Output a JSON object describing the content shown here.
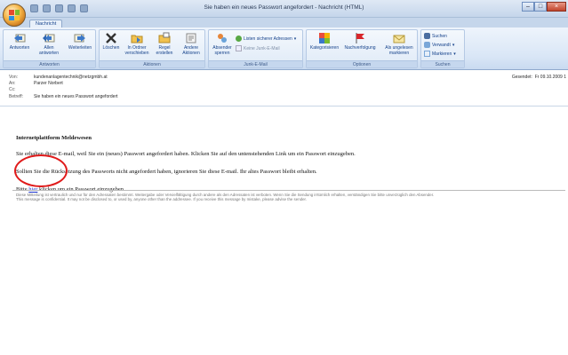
{
  "window": {
    "title": "Sie haben ein neues Passwort angefordert - Nachricht (HTML)"
  },
  "tabs": [
    {
      "label": "Nachricht"
    }
  ],
  "ribbon": {
    "groups": {
      "antworten": {
        "label": "Antworten",
        "buttons": [
          {
            "label": "Antworten",
            "icon": "reply-icon"
          },
          {
            "label": "Allen antworten",
            "icon": "reply-all-icon"
          },
          {
            "label": "Weiterleiten",
            "icon": "forward-icon"
          }
        ]
      },
      "aktionen": {
        "label": "Aktionen",
        "buttons": [
          {
            "label": "Löschen",
            "icon": "delete-icon"
          },
          {
            "label": "In Ordner verschieben",
            "icon": "move-to-folder-icon"
          },
          {
            "label": "Regel erstellen",
            "icon": "rule-icon"
          },
          {
            "label": "Andere Aktionen",
            "icon": "other-actions-icon"
          }
        ]
      },
      "junk": {
        "label": "Junk-E-Mail",
        "button": {
          "label": "Absender sperren",
          "icon": "block-sender-icon"
        },
        "small": [
          {
            "label": "Listen sicherer Adressen",
            "icon": "safe-list-icon"
          },
          {
            "label": "Keine Junk-E-Mail",
            "icon": "not-junk-icon"
          }
        ]
      },
      "optionen": {
        "label": "Optionen",
        "buttons": [
          {
            "label": "Kategorisieren",
            "icon": "categorize-icon"
          },
          {
            "label": "Nachverfolgung",
            "icon": "followup-flag-icon"
          },
          {
            "label": "Als ungelesen markieren",
            "icon": "mark-unread-icon"
          }
        ]
      },
      "suchen": {
        "label": "Suchen",
        "small": [
          {
            "label": "Suchen",
            "icon": "binoculars-icon"
          },
          {
            "label": "Verwandt",
            "icon": "related-icon"
          },
          {
            "label": "Markieren",
            "icon": "select-icon"
          }
        ]
      }
    }
  },
  "header": {
    "from_label": "Von:",
    "from_value": "kundenanlagentechnik@netzgmbh.at",
    "to_label": "An:",
    "to_value": "Parzer Norbert",
    "cc_label": "Cc:",
    "cc_value": "",
    "subject_label": "Betreff:",
    "subject_value": "Sie haben ein neues Passwort angefordert",
    "sent_label": "Gesendet:",
    "sent_value": "Fr 09.10.2009 1"
  },
  "body": {
    "heading": "Internetplattform Meldewesen",
    "para1": "Sie erhalten diese E-mail, weil Sie ein (neues) Passwort angefordert haben. Klicken Sie auf den untenstehenden Link um ein Passwort einzugeben.",
    "para2": "Sollten Sie die Rücksetzung des Passworts nicht angefordert haben, ignorieren Sie diese E-mail. Ihr altes Passwort bleibt erhalten.",
    "para3_before": "Bitte",
    "para3_link": "hier",
    "para3_after": "klicken um ein Passwort einzugeben."
  },
  "disclaimer": {
    "de": "Diese Mitteilung ist vertraulich und nur für den Adressaten bestimmt. Weitergabe oder Vervielfältigung durch andere als den Adressaten ist verboten. Wenn Sie die Sendung irrtümlich erhalten, verständigen Sie bitte unverzüglich den Absender.",
    "en": "This message is confidential. It may not be disclosed to, or used by, anyone other than the addressee. If you receive this message by mistake, please advise the sender."
  },
  "colors": {
    "highlight_circle": "#e01b1b",
    "link": "#1a33cc",
    "ribbon_text": "#15428b"
  }
}
